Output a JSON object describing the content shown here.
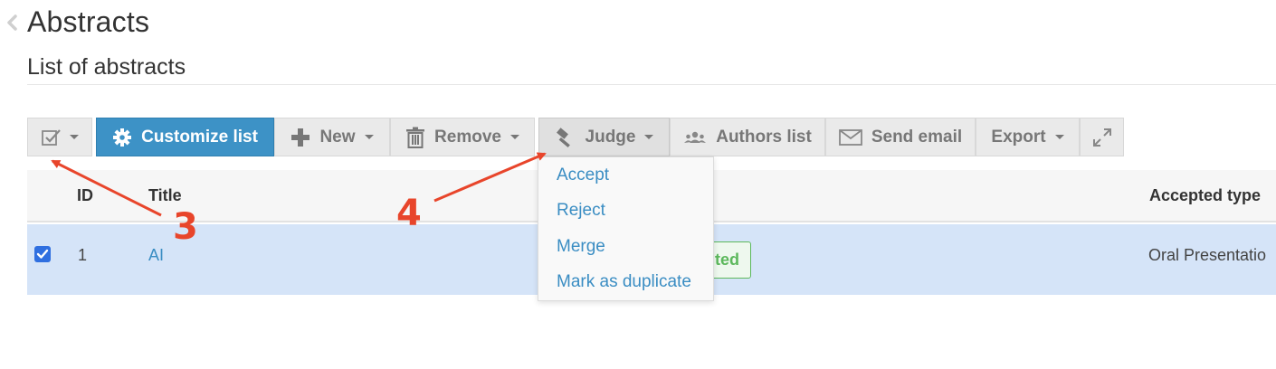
{
  "header": {
    "title": "Abstracts",
    "subtitle": "List of abstracts"
  },
  "toolbar": {
    "select_icon": "checkbox-icon",
    "customize_label": "Customize list",
    "new_label": "New",
    "remove_label": "Remove",
    "judge_label": "Judge",
    "authors_label": "Authors list",
    "email_label": "Send email",
    "export_label": "Export",
    "fullscreen_icon": "expand-icon"
  },
  "judge_menu": {
    "items": [
      "Accept",
      "Reject",
      "Merge",
      "Mark as duplicate"
    ]
  },
  "table": {
    "columns": [
      "ID",
      "Title",
      "Accepted type"
    ],
    "rows": [
      {
        "id": "1",
        "title": "AI",
        "state": "ted",
        "accepted_type": "Oral Presentatio",
        "selected": true
      }
    ]
  },
  "annotations": [
    "3",
    "4"
  ],
  "colors": {
    "primary": "#3d92c6",
    "link": "#3a8dc3",
    "row_selected": "#d5e4f8",
    "success": "#5cb85c",
    "annotation": "#e8452b"
  }
}
